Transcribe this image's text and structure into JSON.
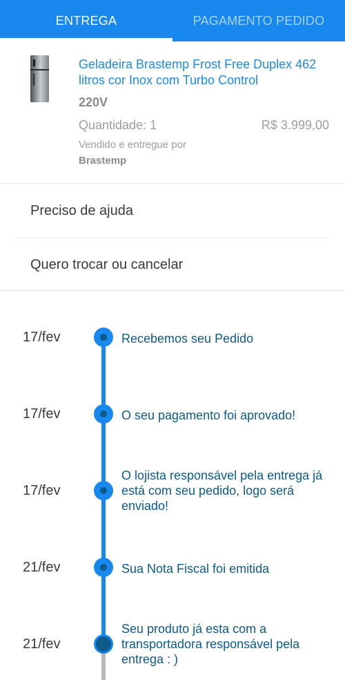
{
  "tabs": [
    {
      "label": "ENTREGA",
      "active": true
    },
    {
      "label": "PAGAMENTO PEDIDO",
      "active": false
    }
  ],
  "colors": {
    "primary": "#1888ef",
    "timeline_text": "#0e5a8a",
    "muted": "#9e9e9e"
  },
  "product": {
    "image_icon": "refrigerator-image",
    "title": "Geladeira Brastemp Frost Free Duplex 462 litros cor Inox com Turbo Control",
    "voltage": "220V",
    "quantity": "Quantidade: 1",
    "price": "R$ 3.999,00",
    "sold_by_label": "Vendido e entregue por",
    "seller": "Brastemp"
  },
  "options": {
    "help": "Preciso de ajuda",
    "exchange": "Quero trocar ou cancelar"
  },
  "timeline": [
    {
      "date": "17/fev",
      "text": "Recebemos seu Pedido"
    },
    {
      "date": "17/fev",
      "text": "O seu pagamento foi aprovado!"
    },
    {
      "date": "17/fev",
      "text": "O lojista responsável pela entrega já está com seu pedido, logo será enviado!"
    },
    {
      "date": "21/fev",
      "text": "Sua Nota Fiscal foi emitida"
    },
    {
      "date": "21/fev",
      "text": "Seu produto já esta com a transportadora responsável pela entrega : )"
    }
  ]
}
